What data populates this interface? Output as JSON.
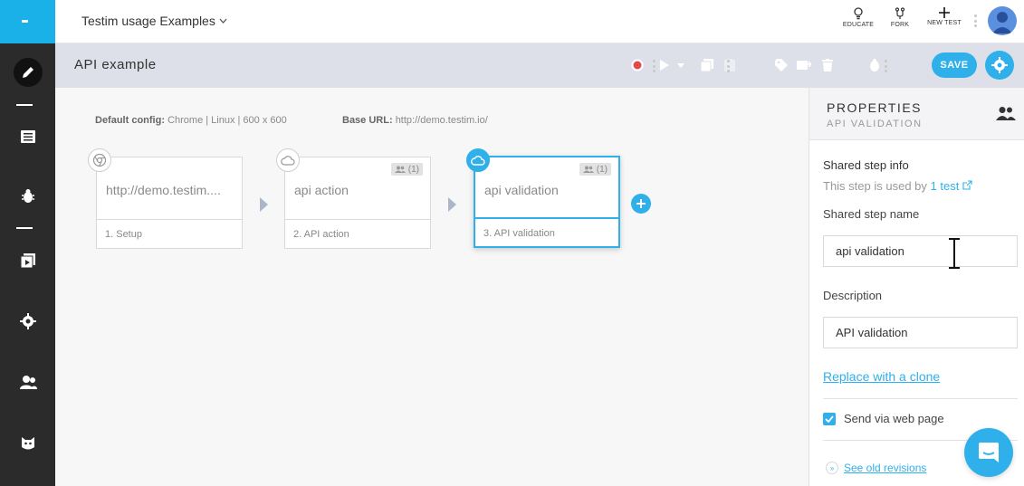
{
  "topbar": {
    "project_name": "Testim usage Examples",
    "actions": [
      {
        "label": "EDUCATE",
        "icon": "lightbulb-icon"
      },
      {
        "label": "FORK",
        "icon": "fork-icon"
      },
      {
        "label": "NEW TEST",
        "icon": "plus-icon"
      }
    ]
  },
  "titlebar": {
    "test_name": "API example",
    "save_label": "SAVE"
  },
  "canvas": {
    "default_config_label": "Default config:",
    "default_config_value": "Chrome | Linux | 600 x 600",
    "base_url_label": "Base URL:",
    "base_url_value": "http://demo.testim.io/",
    "steps": [
      {
        "name": "http://demo.testim....",
        "footer": "1. Setup",
        "icon": "chrome-icon"
      },
      {
        "name": "api action",
        "footer": "2. API action",
        "icon": "cloud-icon",
        "shared_count": "(1)"
      },
      {
        "name": "api validation",
        "footer": "3. API validation",
        "icon": "cloud-icon",
        "shared_count": "(1)"
      }
    ]
  },
  "panel": {
    "title": "PROPERTIES",
    "subtitle": "API VALIDATION",
    "shared_info_title": "Shared step info",
    "used_by_prefix": "This step is used by",
    "used_by_link": "1 test",
    "shared_name_label": "Shared step name",
    "shared_name_value": "api validation",
    "description_label": "Description",
    "description_value": "API validation",
    "replace_link": "Replace with a clone",
    "send_via_label": "Send via web page",
    "send_via_checked": true,
    "revisions_link": "See old revisions"
  },
  "colors": {
    "accent": "#2fb0ea",
    "rail": "#2b2b2b",
    "titlebar": "#dde0e8"
  }
}
